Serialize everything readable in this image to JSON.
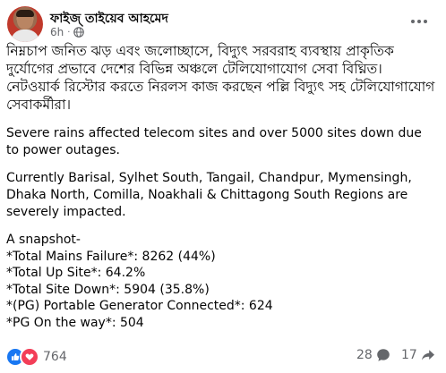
{
  "post": {
    "author": "ফাইজ্ তাইয়েব আহমেদ",
    "time": "6h",
    "dot": "·",
    "bangla_text": "নিম্নচাপ জনিত ঝড় এবং জলোচ্ছাসে, বিদ্যুৎ সরবরাহ ব্যবস্থায় প্রাকৃতিক দুর্যোগের প্রভাবে দেশের বিভিন্ন অঞ্চলে টেলিযোগাযোগ সেবা বিঘ্নিত। নেটওয়ার্ক রিস্টোর করতে নিরলস কাজ করছেন পল্লি বিদ্যুৎ সহ টেলিযোগাযোগ সেবাকর্মীরা।",
    "para1": "Severe rains affected telecom sites and over 5000 sites down due to power outages.",
    "para2": "Currently Barisal, Sylhet South, Tangail, Chandpur, Mymensingh, Dhaka North,  Comilla, Noakhali & Chittagong South Regions are severely impacted.",
    "snapshot": [
      "A snapshot-",
      "*Total Mains Failure*: 8262 (44%)",
      "*Total Up Site*: 64.2%",
      "*Total Site Down*: 5904 (35.8%)",
      "*(PG) Portable Generator  Connected*: 624",
      "*PG On the way*: 504"
    ]
  },
  "footer": {
    "reactions": "764",
    "comments": "28",
    "shares": "17"
  },
  "colors": {
    "like": "#1877f2",
    "love": "#f33e58",
    "secondary_text": "#65676b"
  }
}
